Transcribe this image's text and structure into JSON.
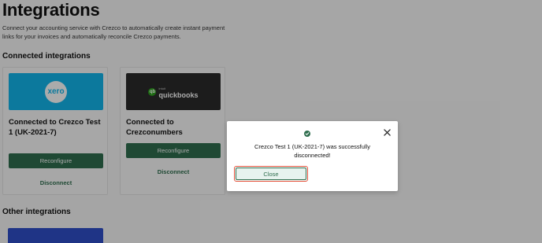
{
  "header": {
    "title": "Integrations",
    "subtitle": "Connect your accounting service with Crezco to automatically create instant payment links for your invoices and automatically reconcile Crezco payments."
  },
  "connected": {
    "section_title": "Connected integrations",
    "cards": [
      {
        "logo_name": "xero",
        "logo_text": "xero",
        "title": "Connected to Crezco Test 1 (UK-2021-7)",
        "reconfigure_label": "Reconfigure",
        "disconnect_label": "Disconnect"
      },
      {
        "logo_name": "quickbooks",
        "logo_small": "intuit",
        "logo_text": "quickbooks",
        "logo_icon": "qb",
        "title": "Connected to Crezconumbers",
        "reconfigure_label": "Reconfigure",
        "disconnect_label": "Disconnect"
      }
    ]
  },
  "other": {
    "section_title": "Other integrations"
  },
  "modal": {
    "message": "Crezco Test 1 (UK-2021-7) was successfully disconnected!",
    "close_label": "Close",
    "icons": {
      "status": "check-circle-icon",
      "dismiss": "close-icon"
    }
  },
  "colors": {
    "brand_green": "#2f6e4e",
    "xero_blue": "#13b5ea",
    "quickbooks_bg": "#2b2b2b",
    "focus_ring": "#e5533d"
  }
}
